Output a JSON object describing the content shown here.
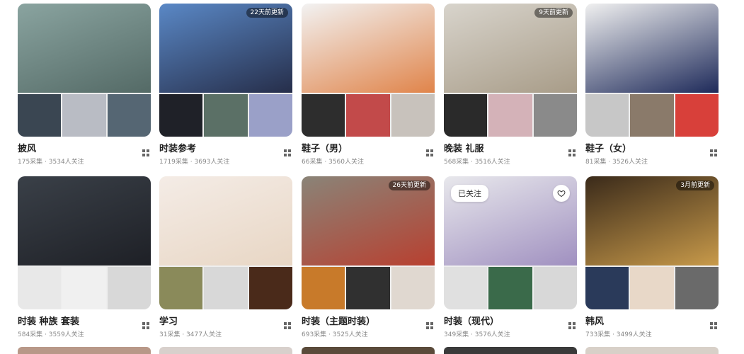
{
  "boards": [
    {
      "title": "披风",
      "stats": "175采集 · 3534人关注",
      "badge": "",
      "colors": {
        "main": [
          "#8aa4a0",
          "#546a66"
        ],
        "thumbs": [
          "#3a4652",
          "#b9bcc4",
          "#556673"
        ]
      }
    },
    {
      "title": "时装参考",
      "stats": "1719采集 · 3693人关注",
      "badge": "22天前更新",
      "colors": {
        "main": [
          "#5a88c6",
          "#262e4a"
        ],
        "thumbs": [
          "#1f2128",
          "#5b7066",
          "#9aa0c8"
        ]
      }
    },
    {
      "title": "鞋子（男）",
      "stats": "66采集 · 3560人关注",
      "badge": "",
      "colors": {
        "main": [
          "#f2f2f2",
          "#e0844a"
        ],
        "thumbs": [
          "#2d2d2d",
          "#c24a4a",
          "#c8c2bc"
        ]
      }
    },
    {
      "title": "晚装 礼服",
      "stats": "568采集 · 3516人关注",
      "badge": "9天前更新",
      "colors": {
        "main": [
          "#d8d4cc",
          "#a89c88"
        ],
        "thumbs": [
          "#2a2a2a",
          "#d4b2b8",
          "#8a8a8a"
        ]
      }
    },
    {
      "title": "鞋子（女）",
      "stats": "81采集 · 3526人关注",
      "badge": "",
      "colors": {
        "main": [
          "#f0f0f0",
          "#1e2a5a"
        ],
        "thumbs": [
          "#c7c7c7",
          "#8a7a6a",
          "#d8403a"
        ]
      }
    },
    {
      "title": "时装 种族 套装",
      "stats": "584采集 · 3559人关注",
      "badge": "",
      "colors": {
        "main": [
          "#3a4048",
          "#1e2026"
        ],
        "thumbs": [
          "#e8e8e8",
          "#f0f0f0",
          "#d8d8d8"
        ]
      }
    },
    {
      "title": "学习",
      "stats": "31采集 · 3477人关注",
      "badge": "",
      "colors": {
        "main": [
          "#f4ece6",
          "#e8d6c4"
        ],
        "thumbs": [
          "#8a8a5a",
          "#d8d8d8",
          "#4a2a1a"
        ]
      }
    },
    {
      "title": "时装（主题时装）",
      "stats": "693采集 · 3525人关注",
      "badge": "26天前更新",
      "colors": {
        "main": [
          "#8a8478",
          "#b84030"
        ],
        "thumbs": [
          "#c87a2a",
          "#303030",
          "#e0d8d0"
        ]
      }
    },
    {
      "title": "时装（现代）",
      "stats": "349采集 · 3576人关注",
      "badge": "",
      "colors": {
        "main": [
          "#e8e8ec",
          "#a090c0"
        ],
        "thumbs": [
          "#e0e0e0",
          "#3a6a4a",
          "#d8d8d8"
        ]
      },
      "hover": {
        "followed_label": "已关注"
      }
    },
    {
      "title": "韩风",
      "stats": "733采集 · 3499人关注",
      "badge": "3月前更新",
      "colors": {
        "main": [
          "#3a2a1a",
          "#c89a4a"
        ],
        "thumbs": [
          "#2a3a5a",
          "#e8d8c8",
          "#6a6a6a"
        ]
      }
    }
  ],
  "icons": {
    "menu": "grid-menu-icon",
    "heart": "heart-icon"
  }
}
